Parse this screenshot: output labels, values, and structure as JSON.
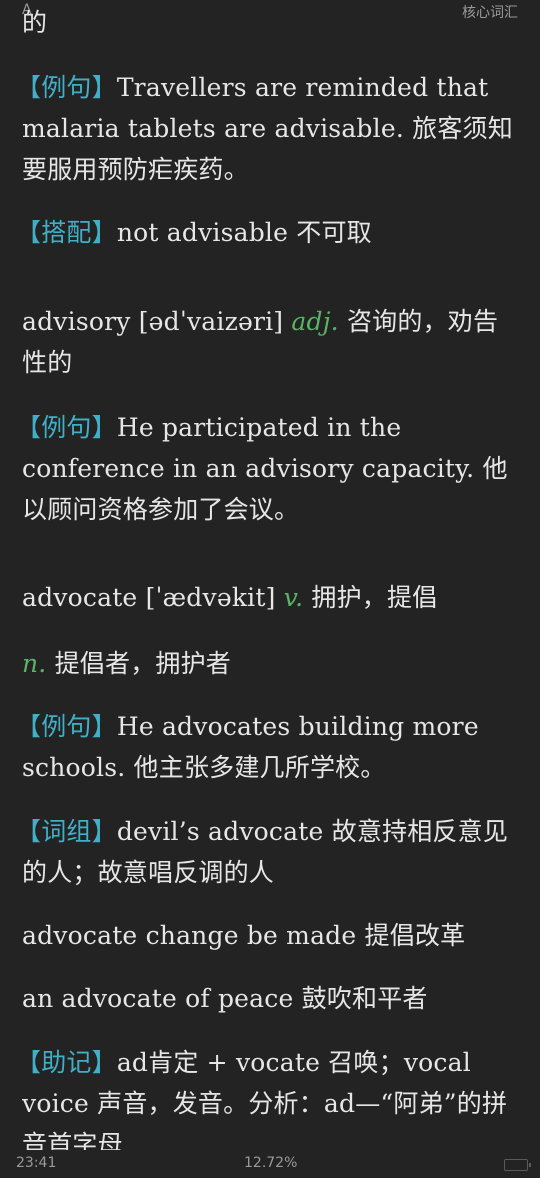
{
  "header": {
    "left_text": "A",
    "book_title": "核心词汇"
  },
  "entries": [
    {
      "kind": "text",
      "text": "的"
    },
    {
      "kind": "example",
      "tag": "【例句】",
      "text": "Travellers are reminded that malaria tablets are advisable. 旅客须知要服用预防疟疾药。"
    },
    {
      "kind": "example",
      "tag": "【搭配】",
      "text": "not advisable 不可取"
    },
    {
      "kind": "word",
      "headword": "advisory [ədˈvaizəri]",
      "pos": "adj.",
      "meaning": "咨询的，劝告性的"
    },
    {
      "kind": "example",
      "tag": "【例句】",
      "text": "He participated in the conference in an advisory capacity. 他以顾问资格参加了会议。"
    },
    {
      "kind": "word",
      "headword": "advocate [ˈædvəkit]",
      "pos": "v.",
      "meaning": "拥护，提倡"
    },
    {
      "kind": "word",
      "headword": "",
      "pos": "n.",
      "meaning": "提倡者，拥护者"
    },
    {
      "kind": "example",
      "tag": "【例句】",
      "text": "He advocates building more schools. 他主张多建几所学校。"
    },
    {
      "kind": "example",
      "tag": "【词组】",
      "text": "devil’s advocate 故意持相反意见的人；故意唱反调的人"
    },
    {
      "kind": "text",
      "text": "advocate change be made 提倡改革"
    },
    {
      "kind": "text",
      "text": "an advocate of peace 鼓吹和平者"
    },
    {
      "kind": "example",
      "tag": "【助记】",
      "text": "ad肯定 + vocate 召唤；vocal voice 声音，发音。分析：ad—“阿弟”的拼音首字母"
    }
  ],
  "status": {
    "time": "23:41",
    "progress": "12.72%"
  }
}
